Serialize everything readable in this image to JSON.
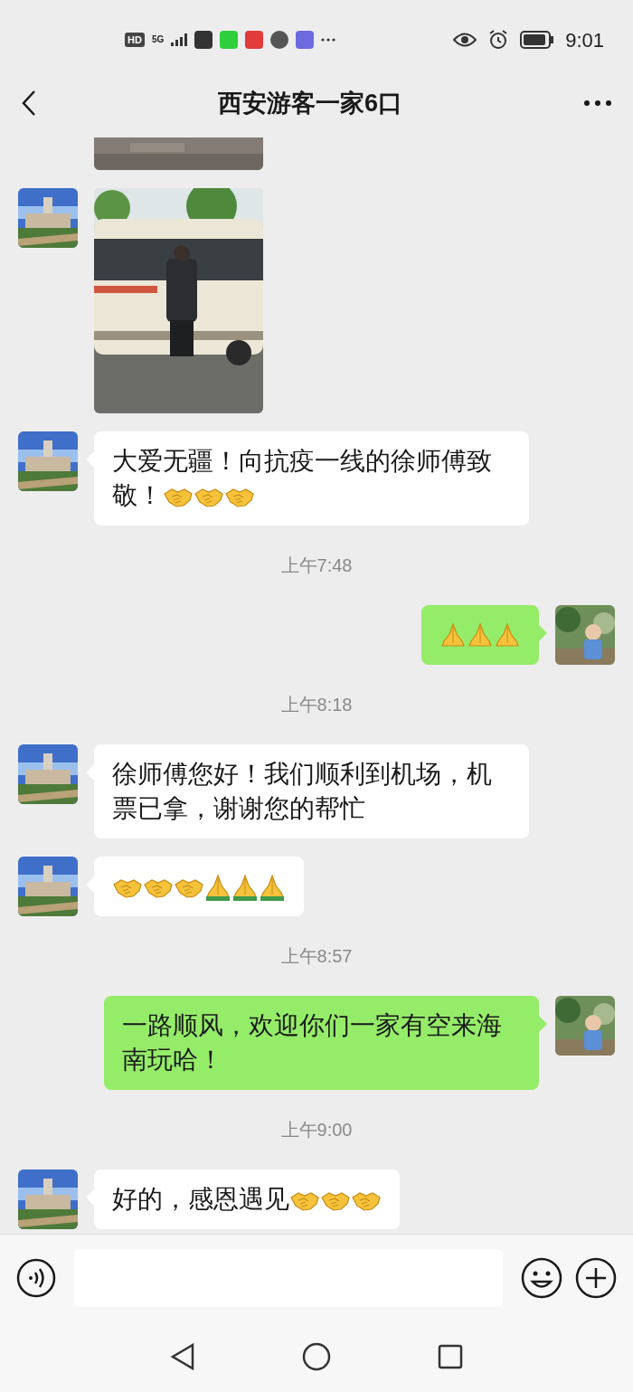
{
  "status_bar": {
    "badges": [
      "HD",
      "5G"
    ],
    "time": "9:01"
  },
  "header": {
    "title": "西安游客一家6口"
  },
  "messages": [
    {
      "kind": "picture_cut"
    },
    {
      "kind": "picture",
      "outgoing": false
    },
    {
      "kind": "text",
      "outgoing": false,
      "parts": [
        {
          "kind": "text",
          "text": "大爱无疆！向抗疫一线的徐师傅致敬！"
        },
        {
          "kind": "handshake"
        },
        {
          "kind": "handshake"
        },
        {
          "kind": "handshake"
        }
      ]
    },
    {
      "kind": "time",
      "text": "上午7:48"
    },
    {
      "kind": "text",
      "outgoing": true,
      "parts": [
        {
          "kind": "pray"
        },
        {
          "kind": "pray"
        },
        {
          "kind": "pray"
        }
      ]
    },
    {
      "kind": "time",
      "text": "上午8:18"
    },
    {
      "kind": "text",
      "outgoing": false,
      "parts": [
        {
          "kind": "text",
          "text": "徐师傅您好！我们顺利到机场，机票已拿，谢谢您的帮忙"
        }
      ]
    },
    {
      "kind": "text",
      "outgoing": false,
      "parts": [
        {
          "kind": "handshake"
        },
        {
          "kind": "handshake"
        },
        {
          "kind": "handshake"
        },
        {
          "kind": "pray_sleeve"
        },
        {
          "kind": "pray_sleeve"
        },
        {
          "kind": "pray_sleeve"
        }
      ]
    },
    {
      "kind": "time",
      "text": "上午8:57"
    },
    {
      "kind": "text",
      "outgoing": true,
      "parts": [
        {
          "kind": "text",
          "text": "一路顺风，欢迎你们一家有空来海南玩哈！"
        }
      ]
    },
    {
      "kind": "time",
      "text": "上午9:00"
    },
    {
      "kind": "text",
      "outgoing": false,
      "parts": [
        {
          "kind": "text",
          "text": "好的，感恩遇见"
        },
        {
          "kind": "handshake"
        },
        {
          "kind": "handshake"
        },
        {
          "kind": "handshake"
        }
      ]
    }
  ]
}
